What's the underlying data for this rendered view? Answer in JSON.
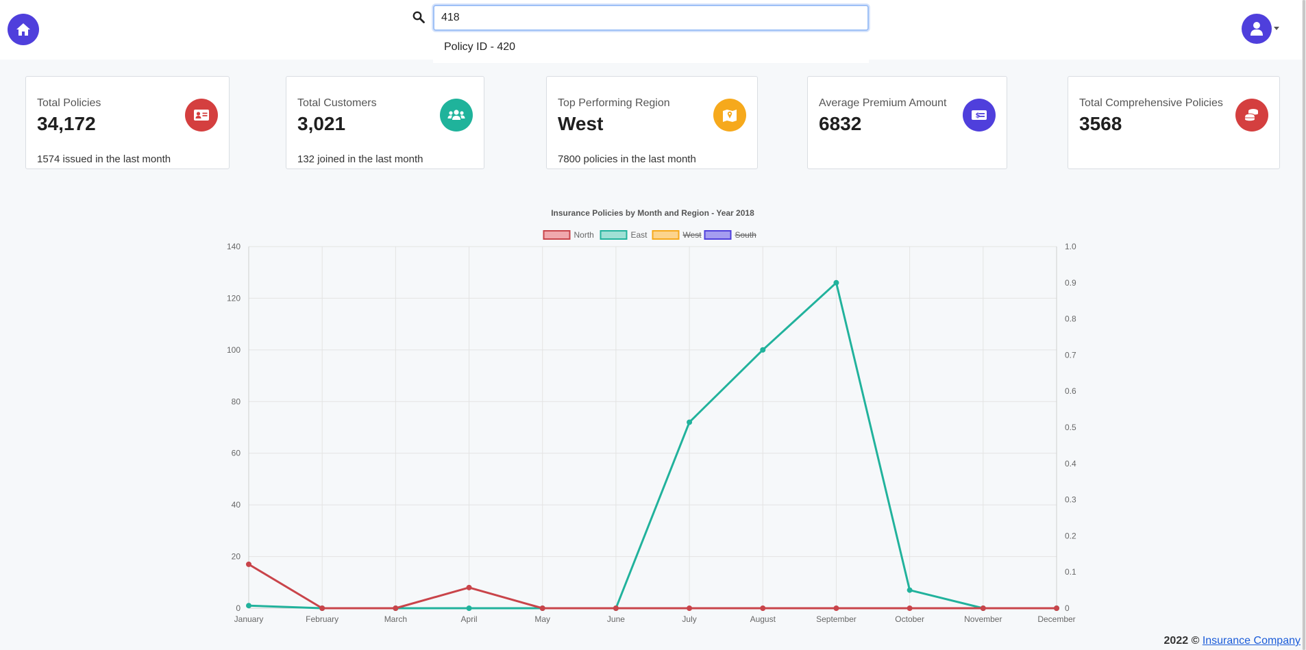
{
  "header": {
    "search": {
      "value": "418",
      "placeholder": ""
    },
    "suggestion": "Policy ID - 420"
  },
  "cards": [
    {
      "title": "Total Policies",
      "value": "34,172",
      "sub": "1574 issued in the last month",
      "icon": "id-card-icon",
      "color": "#d43f3f"
    },
    {
      "title": "Total Customers",
      "value": "3,021",
      "sub": "132 joined in the last month",
      "icon": "users-icon",
      "color": "#1fb39b"
    },
    {
      "title": "Top Performing Region",
      "value": "West",
      "sub": "7800 policies in the last month",
      "icon": "map-icon",
      "color": "#f6a91c"
    },
    {
      "title": "Average Premium Amount",
      "value": "6832",
      "sub": "",
      "icon": "money-icon",
      "color": "#4f3fdc"
    },
    {
      "title": "Total Comprehensive Policies",
      "value": "3568",
      "sub": "",
      "icon": "coins-icon",
      "color": "#d43f3f"
    }
  ],
  "chart_data": {
    "type": "line",
    "title": "Insurance Policies by Month and Region - Year 2018",
    "categories": [
      "January",
      "February",
      "March",
      "April",
      "May",
      "June",
      "July",
      "August",
      "September",
      "October",
      "November",
      "December"
    ],
    "ylim": [
      0,
      140
    ],
    "yticks": [
      0,
      20,
      40,
      60,
      80,
      100,
      120,
      140
    ],
    "y2lim": [
      0,
      1
    ],
    "y2ticks": [
      "0",
      "0.1",
      "0.2",
      "0.3",
      "0.4",
      "0.5",
      "0.6",
      "0.7",
      "0.8",
      "0.9",
      "1.0"
    ],
    "grid": true,
    "legend_position": "top",
    "series": [
      {
        "name": "North",
        "color": "#c9444a",
        "fill": "#f0a8ad",
        "hidden": false,
        "values": [
          17,
          0,
          0,
          8,
          0,
          0,
          0,
          0,
          0,
          0,
          0,
          0
        ]
      },
      {
        "name": "East",
        "color": "#21b29c",
        "fill": "#9fe0d5",
        "hidden": false,
        "values": [
          1,
          0,
          0,
          0,
          0,
          0,
          72,
          100,
          126,
          7,
          0,
          0
        ]
      },
      {
        "name": "West",
        "color": "#f6a91c",
        "fill": "#fcd48d",
        "hidden": true,
        "values": []
      },
      {
        "name": "South",
        "color": "#4f3fdc",
        "fill": "#a59df0",
        "hidden": true,
        "values": []
      }
    ]
  },
  "footer": {
    "year": "2022 ©",
    "company": "Insurance Company"
  }
}
